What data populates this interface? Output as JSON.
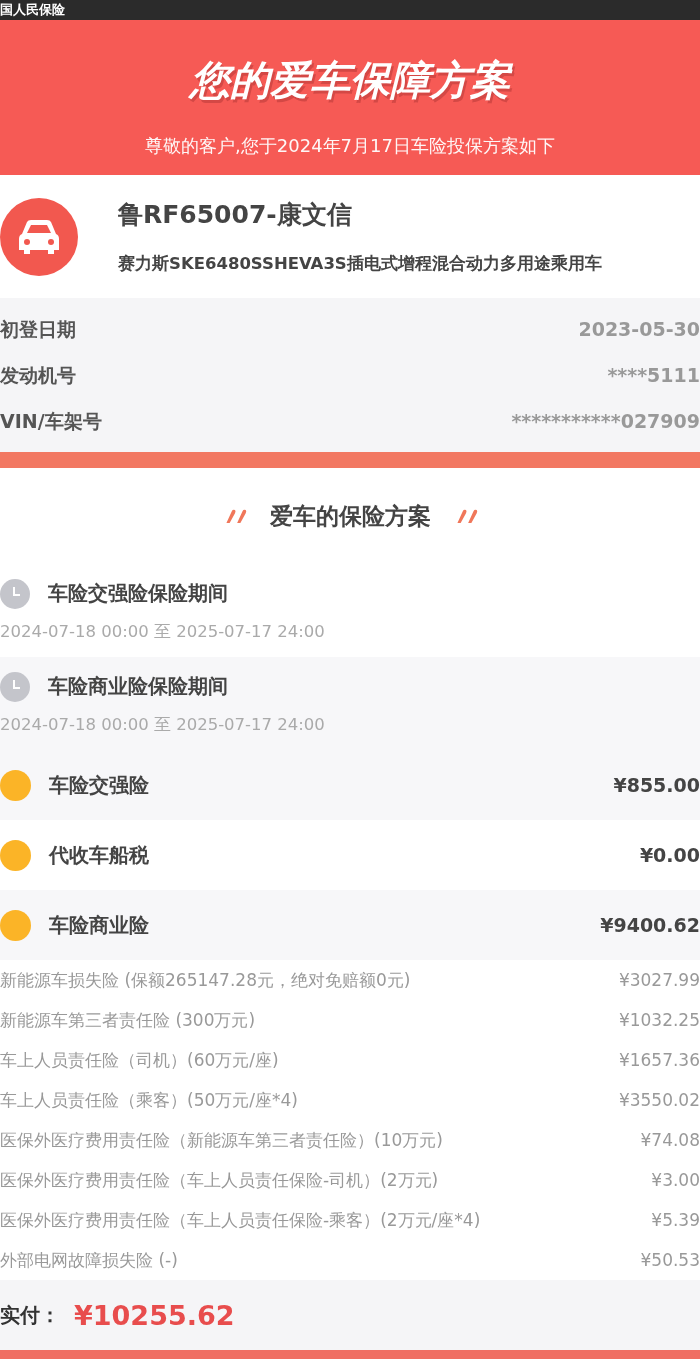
{
  "status_bar": {
    "app_name": "国人民保险"
  },
  "header": {
    "title": "您的爱车保障方案",
    "subtitle": "尊敬的客户,您于2024年7月17日车险投保方案如下"
  },
  "vehicle": {
    "plate": "鲁RF65007-康文信",
    "model": "赛力斯SKE6480SSHEVA3S插电式增程混合动力多用途乘用车"
  },
  "vehicle_info": [
    {
      "label": "初登日期",
      "value": "2023-05-30"
    },
    {
      "label": "发动机号",
      "value": "****5111"
    },
    {
      "label": "VIN/车架号",
      "value": "***********027909"
    }
  ],
  "plan_section": {
    "title": "爱车的保险方案"
  },
  "periods": [
    {
      "title": "车险交强险保险期间",
      "range": "2024-07-18 00:00 至 2025-07-17 24:00"
    },
    {
      "title": "车险商业险保险期间",
      "range": "2024-07-18 00:00 至 2025-07-17 24:00"
    }
  ],
  "fees": [
    {
      "name": "车险交强险",
      "amount": "¥855.00"
    },
    {
      "name": "代收车船税",
      "amount": "¥0.00"
    },
    {
      "name": "车险商业险",
      "amount": "¥9400.62"
    }
  ],
  "commercial_items": [
    {
      "name": "新能源车损失险 (保额265147.28元，绝对免赔额0元)",
      "amount": "¥3027.99"
    },
    {
      "name": "新能源车第三者责任险 (300万元)",
      "amount": "¥1032.25"
    },
    {
      "name": "车上人员责任险（司机）(60万元/座)",
      "amount": "¥1657.36"
    },
    {
      "name": "车上人员责任险（乘客）(50万元/座*4)",
      "amount": "¥3550.02"
    },
    {
      "name": "医保外医疗费用责任险（新能源车第三者责任险）(10万元)",
      "amount": "¥74.08"
    },
    {
      "name": "医保外医疗费用责任险（车上人员责任保险-司机）(2万元)",
      "amount": "¥3.00"
    },
    {
      "name": "医保外医疗费用责任险（车上人员责任保险-乘客）(2万元/座*4)",
      "amount": "¥5.39"
    },
    {
      "name": "外部电网故障损失险 (-)",
      "amount": "¥50.53"
    }
  ],
  "total": {
    "label": "实付：",
    "amount": "¥10255.62"
  }
}
